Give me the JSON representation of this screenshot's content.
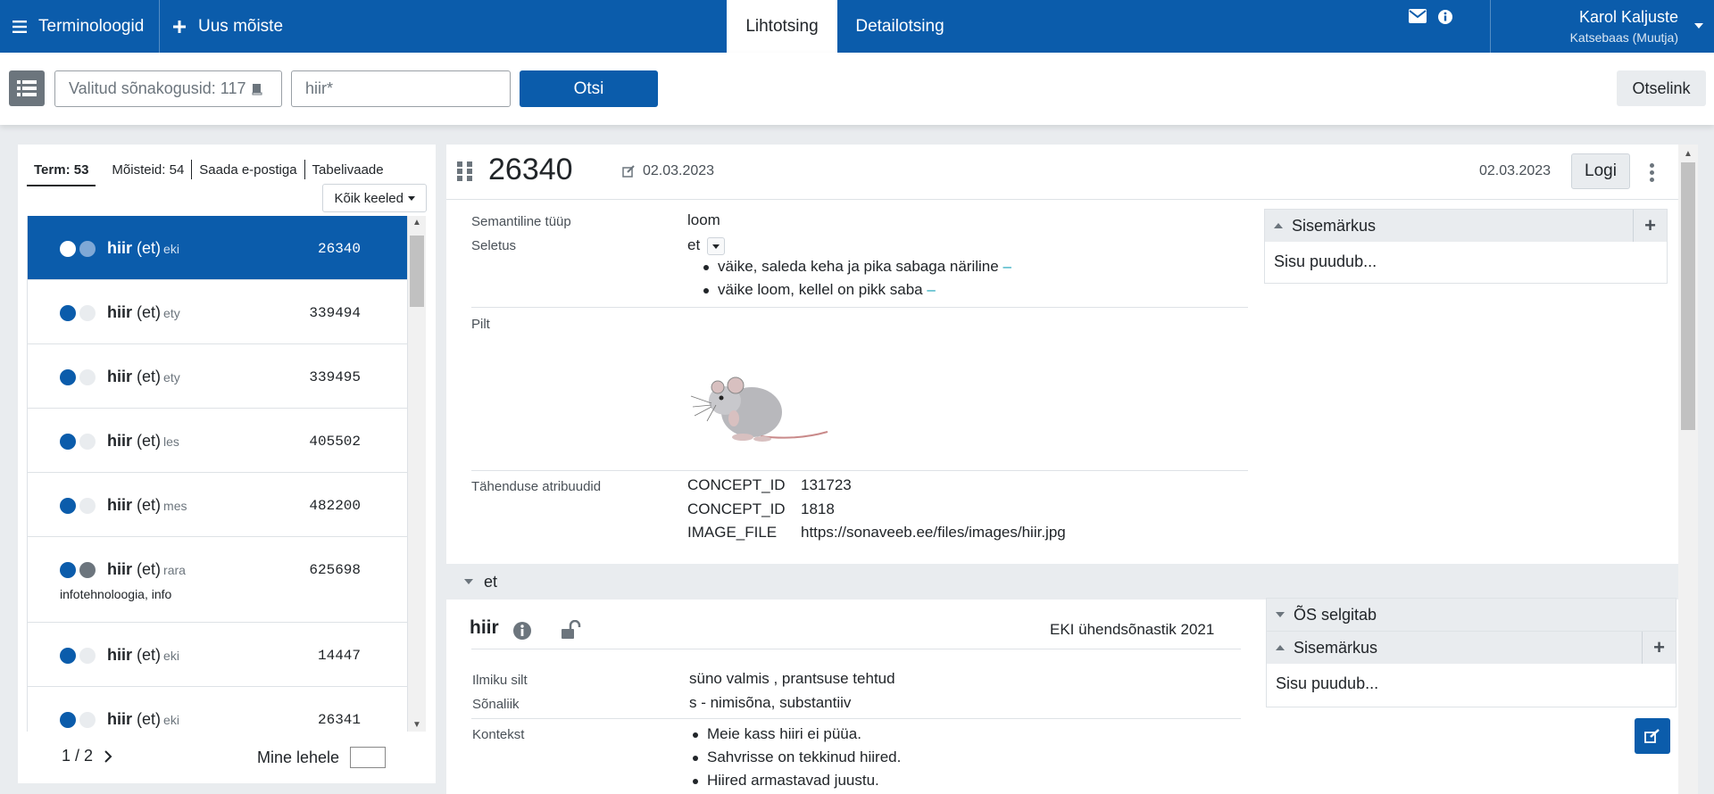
{
  "header": {
    "app_name": "Terminoloogid",
    "new_concept": "Uus mõiste",
    "tabs": [
      "Lihtotsing",
      "Detailotsing"
    ],
    "user_name": "Karol Kaljuste",
    "user_role": "Katsebaas (Muutja)"
  },
  "search": {
    "datasets": "Valitud sõnakogusid: 117",
    "query": "hiir*",
    "search_button": "Otsi",
    "permalink": "Otselink"
  },
  "results": {
    "tabs": [
      "Term: 53",
      "Mõisteid: 54",
      "Saada e-postiga",
      "Tabelivaade"
    ],
    "lang_filter": "Kõik keeled",
    "items": [
      {
        "word": "hiir",
        "lang": "(et)",
        "src": "eki",
        "id": "26340",
        "domain": ""
      },
      {
        "word": "hiir",
        "lang": "(et)",
        "src": "ety",
        "id": "339494",
        "domain": ""
      },
      {
        "word": "hiir",
        "lang": "(et)",
        "src": "ety",
        "id": "339495",
        "domain": ""
      },
      {
        "word": "hiir",
        "lang": "(et)",
        "src": "les",
        "id": "405502",
        "domain": ""
      },
      {
        "word": "hiir",
        "lang": "(et)",
        "src": "mes",
        "id": "482200",
        "domain": ""
      },
      {
        "word": "hiir",
        "lang": "(et)",
        "src": "rara",
        "id": "625698",
        "domain": "infotehnoloogia, info"
      },
      {
        "word": "hiir",
        "lang": "(et)",
        "src": "eki",
        "id": "14447",
        "domain": ""
      },
      {
        "word": "hiir",
        "lang": "(et)",
        "src": "eki",
        "id": "26341",
        "domain": ""
      }
    ],
    "pager": "1 / 2",
    "goto_page": "Mine lehele"
  },
  "detail": {
    "concept_id": "26340",
    "edit_date": "02.03.2023",
    "modified_date": "02.03.2023",
    "log_button": "Logi",
    "semantic_type_label": "Semantiline tüüp",
    "semantic_type": "loom",
    "definition_label": "Seletus",
    "definition_lang": "et",
    "definitions": [
      "väike, saleda keha ja pika sabaga näriline",
      "väike loom, kellel on pikk saba"
    ],
    "image_label": "Pilt",
    "attributes_label": "Tähenduse atribuudid",
    "attributes": [
      {
        "key": "CONCEPT_ID",
        "value": "131723"
      },
      {
        "key": "CONCEPT_ID",
        "value": "1818"
      },
      {
        "key": "IMAGE_FILE",
        "value": "https://sonaveeb.ee/files/images/hiir.jpg"
      }
    ],
    "note_title": "Sisemärkus",
    "note_empty": "Sisu puudub...",
    "lang_section": "et",
    "term_word": "hiir",
    "term_dataset": "EKI ühendsõnastik 2021",
    "os_title": "ÕS selgitab",
    "register_label": "Ilmiku silt",
    "register_value": "süno valmis , prantsuse tehtud",
    "pos_label": "Sõnaliik",
    "pos_value": "s - nimisõna, substantiiv",
    "context_label": "Kontekst",
    "contexts": [
      "Meie kass hiiri ei püüa.",
      "Sahvrisse on tekkinud hiired.",
      "Hiired armastavad juustu."
    ],
    "dash": "–"
  },
  "colors": {
    "primary": "#0b5cab",
    "dot_dark": "#0b5cab",
    "dot_light": "#e9ecef",
    "dot_gray": "#6c757d"
  }
}
